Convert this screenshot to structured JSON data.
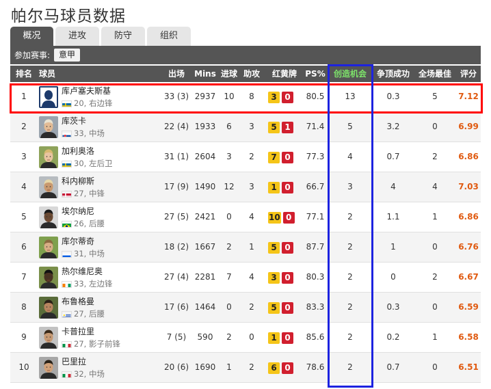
{
  "page_title": "帕尔马球员数据",
  "tabs": [
    {
      "label": "概况",
      "active": true
    },
    {
      "label": "进攻",
      "active": false
    },
    {
      "label": "防守",
      "active": false
    },
    {
      "label": "组织",
      "active": false
    }
  ],
  "filter": {
    "label": "参加赛事:",
    "selected": "意甲"
  },
  "columns": {
    "rank": "排名",
    "player": "球员",
    "apps": "出场",
    "mins": "Mins",
    "goals": "进球",
    "assists": "助攻",
    "cards": "红黄牌",
    "ps": "PS%",
    "key_passes": "创造机会",
    "aerial": "争顶成功",
    "motm": "全场最佳",
    "rating": "评分"
  },
  "colors": {
    "header_bg": "#555555",
    "rating": "#e05a10",
    "highlight_row": "#ff0000",
    "highlight_col": "#1d23e0",
    "creative_header": "#7de26a"
  },
  "players": [
    {
      "rank": "1",
      "name": "库卢塞夫斯基",
      "flag": "sweden",
      "meta": "20, 右边锋",
      "apps": "33 (3)",
      "mins": "2937",
      "goals": "10",
      "assists": "8",
      "yellow": "3",
      "red": "0",
      "ps": "80.5",
      "key_passes": "13",
      "aerial": "0.3",
      "motm": "5",
      "rating": "7.12",
      "avatar": "silhouette"
    },
    {
      "rank": "2",
      "name": "库茨卡",
      "flag": "slovakia",
      "meta": "33, 中场",
      "apps": "22 (4)",
      "mins": "1933",
      "goals": "6",
      "assists": "3",
      "yellow": "5",
      "red": "1",
      "ps": "71.4",
      "key_passes": "5",
      "aerial": "3.2",
      "motm": "0",
      "rating": "6.99",
      "avatar": "photo"
    },
    {
      "rank": "3",
      "name": "加利奥洛",
      "flag": "sweden",
      "meta": "30, 左后卫",
      "apps": "31 (1)",
      "mins": "2604",
      "goals": "3",
      "assists": "2",
      "yellow": "7",
      "red": "0",
      "ps": "77.3",
      "key_passes": "4",
      "aerial": "0.7",
      "motm": "2",
      "rating": "6.86",
      "avatar": "photo"
    },
    {
      "rank": "4",
      "name": "科内柳斯",
      "flag": "denmark",
      "meta": "27, 中锋",
      "apps": "17 (9)",
      "mins": "1490",
      "goals": "12",
      "assists": "3",
      "yellow": "1",
      "red": "0",
      "ps": "66.7",
      "key_passes": "3",
      "aerial": "4",
      "motm": "4",
      "rating": "7.03",
      "avatar": "photo"
    },
    {
      "rank": "5",
      "name": "埃尔纳尼",
      "flag": "brazil",
      "meta": "26, 后腰",
      "apps": "27 (5)",
      "mins": "2421",
      "goals": "0",
      "assists": "4",
      "yellow": "10",
      "red": "0",
      "ps": "77.1",
      "key_passes": "2",
      "aerial": "1.1",
      "motm": "1",
      "rating": "6.86",
      "avatar": "photo"
    },
    {
      "rank": "6",
      "name": "库尔蒂奇",
      "flag": "slovenia",
      "meta": "31, 中场",
      "apps": "18 (2)",
      "mins": "1667",
      "goals": "2",
      "assists": "1",
      "yellow": "5",
      "red": "0",
      "ps": "87.7",
      "key_passes": "2",
      "aerial": "1",
      "motm": "0",
      "rating": "6.76",
      "avatar": "photo"
    },
    {
      "rank": "7",
      "name": "热尔维尼奥",
      "flag": "ivorycoast",
      "meta": "33, 左边锋",
      "apps": "27 (4)",
      "mins": "2281",
      "goals": "7",
      "assists": "4",
      "yellow": "3",
      "red": "0",
      "ps": "80.3",
      "key_passes": "2",
      "aerial": "0",
      "motm": "2",
      "rating": "6.67",
      "avatar": "photo"
    },
    {
      "rank": "8",
      "name": "布鲁格曼",
      "flag": "uruguay",
      "meta": "27, 后腰",
      "apps": "17 (6)",
      "mins": "1464",
      "goals": "0",
      "assists": "2",
      "yellow": "5",
      "red": "0",
      "ps": "83.3",
      "key_passes": "2",
      "aerial": "0.3",
      "motm": "0",
      "rating": "6.59",
      "avatar": "photo"
    },
    {
      "rank": "9",
      "name": "卡普拉里",
      "flag": "italy",
      "meta": "27, 影子前锋",
      "apps": "7 (5)",
      "mins": "590",
      "goals": "2",
      "assists": "0",
      "yellow": "1",
      "red": "0",
      "ps": "85.6",
      "key_passes": "2",
      "aerial": "0.2",
      "motm": "1",
      "rating": "6.58",
      "avatar": "photo"
    },
    {
      "rank": "10",
      "name": "巴里拉",
      "flag": "italy",
      "meta": "32, 中场",
      "apps": "20 (6)",
      "mins": "1690",
      "goals": "1",
      "assists": "2",
      "yellow": "6",
      "red": "0",
      "ps": "78.6",
      "key_passes": "2",
      "aerial": "0.7",
      "motm": "0",
      "rating": "6.51",
      "avatar": "photo"
    }
  ]
}
